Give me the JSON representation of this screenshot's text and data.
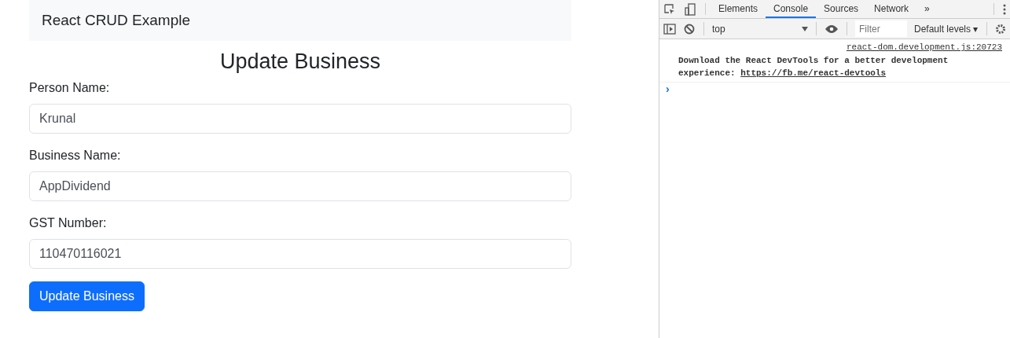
{
  "app": {
    "brand": "React CRUD Example",
    "heading": "Update Business",
    "fields": [
      {
        "label": "Person Name:",
        "value": "Krunal"
      },
      {
        "label": "Business Name:",
        "value": "AppDividend"
      },
      {
        "label": "GST Number:",
        "value": "110470116021"
      }
    ],
    "submit": "Update Business"
  },
  "devtools": {
    "tabs": [
      {
        "label": "Elements",
        "selected": false
      },
      {
        "label": "Console",
        "selected": true
      },
      {
        "label": "Sources",
        "selected": false
      },
      {
        "label": "Network",
        "selected": false
      }
    ],
    "more_tabs": "»",
    "context": "top",
    "filter": {
      "placeholder": "Filter"
    },
    "levels": "Default levels ▾",
    "messages": [
      {
        "source": "react-dom.development.js:20723",
        "text": "Download the React DevTools for a better development experience: ",
        "link": "https://fb.me/react-devtools"
      }
    ],
    "prompt": "›"
  }
}
